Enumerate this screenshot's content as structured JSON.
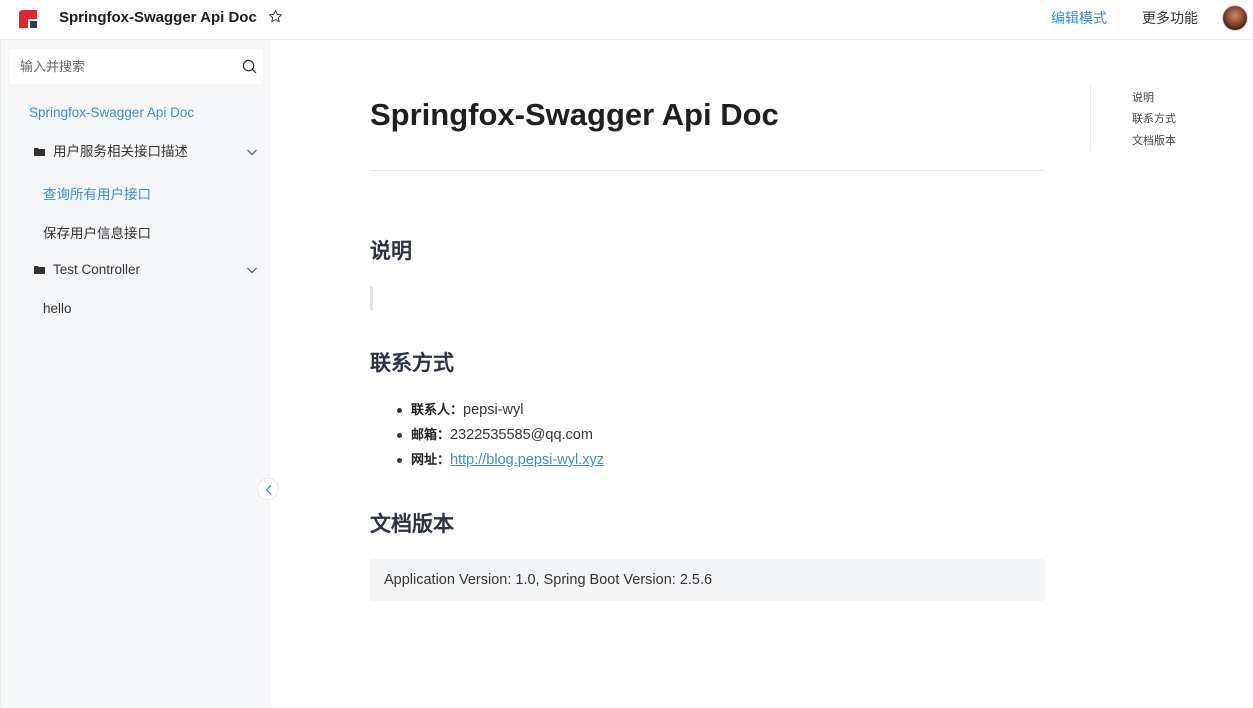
{
  "header": {
    "title": "Springfox-Swagger Api Doc",
    "edit_mode": "编辑模式",
    "more_functions": "更多功能"
  },
  "sidebar": {
    "search_placeholder": "输入并搜索",
    "root": "Springfox-Swagger Api Doc",
    "groups": [
      {
        "label": "用户服务相关接口描述",
        "items": [
          "查询所有用户接口",
          "保存用户信息接口"
        ]
      },
      {
        "label": "Test Controller",
        "items": [
          "hello"
        ]
      }
    ],
    "active_item": "查询所有用户接口"
  },
  "main": {
    "title": "Springfox-Swagger Api Doc",
    "sections": {
      "description": {
        "heading": "说明"
      },
      "contact": {
        "heading": "联系方式",
        "items": [
          {
            "key": "联系人：",
            "value": "pepsi-wyl"
          },
          {
            "key": "邮箱：",
            "value": "2322535585@qq.com"
          },
          {
            "key": "网址：",
            "value": "http://blog.pepsi-wyl.xyz"
          }
        ]
      },
      "version": {
        "heading": "文档版本",
        "text": "Application Version: 1.0, Spring Boot Version: 2.5.6"
      }
    }
  },
  "toc": {
    "items": [
      "说明",
      "联系方式",
      "文档版本"
    ]
  },
  "colors": {
    "accent": "#3b8cdb",
    "logo_red": "#e3262d",
    "sidebar_bg": "#f5f6f8"
  }
}
